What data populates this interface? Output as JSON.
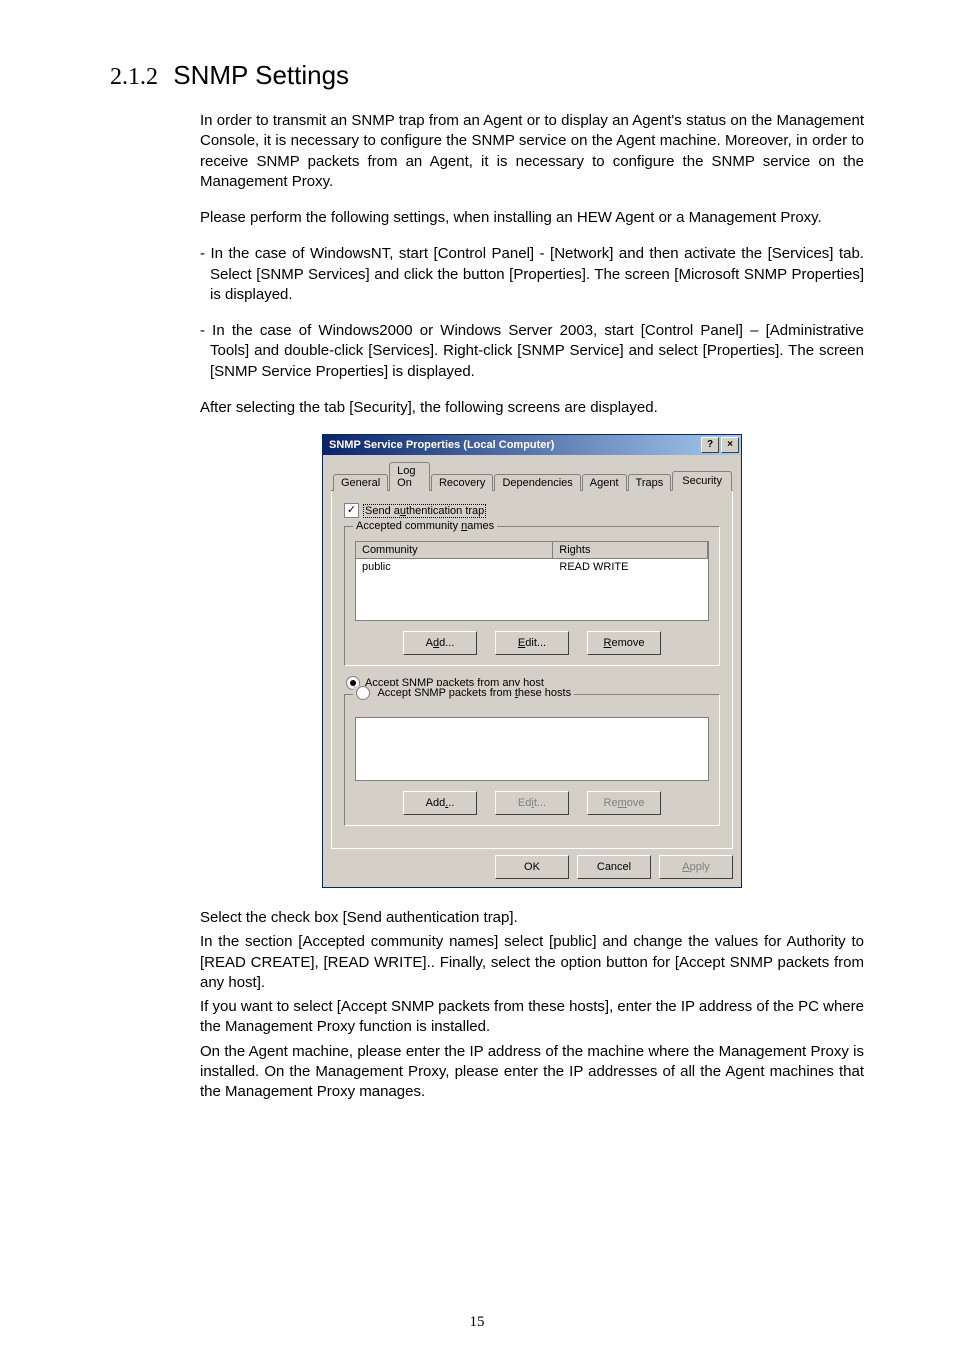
{
  "section": {
    "number": "2.1.2",
    "title": "SNMP Settings"
  },
  "paras": {
    "intro": "In order to transmit an SNMP trap from an Agent or to display an Agent's status on the Management Console, it is necessary to configure the SNMP service on the Agent machine. Moreover, in order to receive SNMP packets from an Agent, it is necessary to configure the SNMP service on the Management Proxy.",
    "please": "Please perform the following settings, when installing an HEW Agent or a Management Proxy.",
    "case_nt": "- In the case of WindowsNT, start [Control Panel] - [Network] and then activate the [Services] tab. Select [SNMP Services] and click the button [Properties]. The screen [Microsoft SNMP Properties] is displayed.",
    "case_2000": "- In the case of Windows2000 or Windows Server 2003, start [Control Panel] – [Administrative Tools] and double-click [Services]. Right-click [SNMP Service] and select [Properties]. The screen [SNMP Service Properties] is displayed.",
    "after_select": "After selecting the tab [Security], the following screens are displayed.",
    "post1": "Select the check box [Send authentication trap].",
    "post2": "In the section [Accepted community names] select [public] and change the values for Authority to [READ CREATE], [READ WRITE].. Finally, select the option button for [Accept SNMP packets from any host].",
    "post3": "If you want to select [Accept SNMP packets from these hosts], enter the IP address of the PC where the Management Proxy function is installed.",
    "post4": "On the Agent machine, please enter the IP address of the machine where the Management Proxy is installed. On the Management Proxy, please enter the IP addresses of all the Agent machines that the Management Proxy manages."
  },
  "dialog": {
    "title": "SNMP Service Properties (Local Computer)",
    "help_glyph": "?",
    "close_glyph": "×",
    "tabs": {
      "general": "General",
      "logon": "Log On",
      "recovery": "Recovery",
      "dependencies": "Dependencies",
      "agent": "Agent",
      "traps": "Traps",
      "security": "Security"
    },
    "send_auth_trap": "Send authentication trap",
    "send_auth_checked": "✓",
    "group_accepted": "Accepted community names",
    "col_community": "Community",
    "col_rights": "Rights",
    "row1_community": "public",
    "row1_rights": "READ WRITE",
    "btn_add": "Add...",
    "btn_edit": "Edit...",
    "btn_remove": "Remove",
    "radio_any": "Accept SNMP packets from any host",
    "radio_these": "Accept SNMP packets from these hosts",
    "btn_add2": "Add...",
    "btn_edit2": "Edit...",
    "btn_remove2": "Remove",
    "btn_ok": "OK",
    "btn_cancel": "Cancel",
    "btn_apply": "Apply"
  },
  "page_number": "15"
}
